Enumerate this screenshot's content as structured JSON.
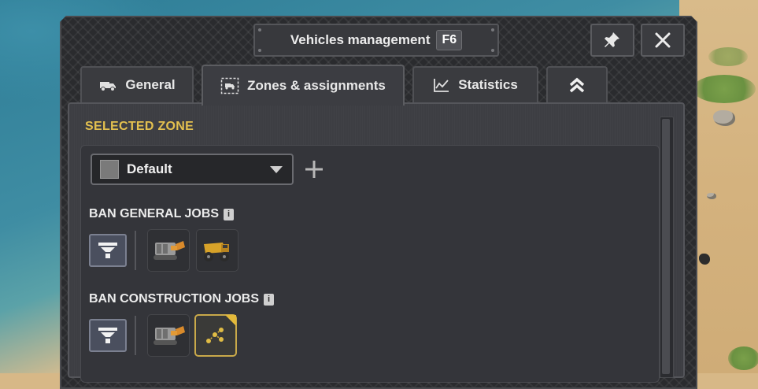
{
  "window": {
    "title": "Vehicles management",
    "hotkey": "F6"
  },
  "tabs": [
    {
      "label": "General",
      "icon": "truck-icon"
    },
    {
      "label": "Zones & assignments",
      "icon": "zone-truck-icon",
      "active": true
    },
    {
      "label": "Statistics",
      "icon": "chart-icon"
    },
    {
      "label": "",
      "icon": "double-chevron-up-icon"
    }
  ],
  "top_buttons": [
    {
      "icon": "pin-icon"
    },
    {
      "icon": "close-icon"
    }
  ],
  "zone": {
    "section_title": "SELECTED ZONE",
    "selected": "Default",
    "swatch_color": "#7a7a7a"
  },
  "general_jobs": {
    "label": "BAN GENERAL JOBS",
    "info": "i",
    "vehicles": [
      {
        "icon": "excavator-vehicle-icon",
        "selected": false
      },
      {
        "icon": "mining-truck-vehicle-icon",
        "selected": false
      }
    ]
  },
  "construction_jobs": {
    "label": "BAN CONSTRUCTION JOBS",
    "info": "i",
    "vehicles": [
      {
        "icon": "excavator-vehicle-icon",
        "selected": false
      },
      {
        "icon": "network-nodes-icon",
        "selected": true
      }
    ]
  },
  "colors": {
    "accent_gold": "#e3c04f",
    "panel_bg": "#3d3e43",
    "window_bg": "#2a2b2e"
  }
}
